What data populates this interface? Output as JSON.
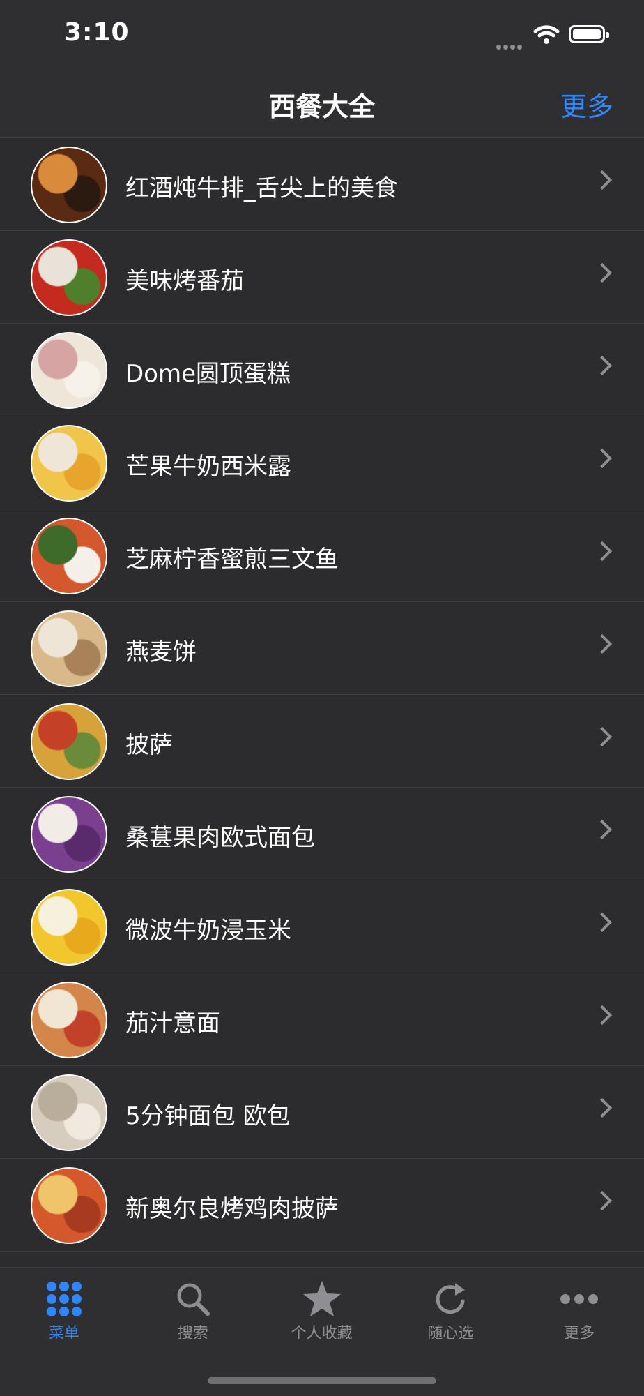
{
  "status": {
    "time": "3:10"
  },
  "nav": {
    "title": "西餐大全",
    "more": "更多"
  },
  "items": [
    {
      "label": "红酒炖牛排_舌尖上的美食",
      "colors": [
        "#5a2a12",
        "#d98a3a",
        "#2b1a10"
      ]
    },
    {
      "label": "美味烤番茄",
      "colors": [
        "#c42a1e",
        "#e8e2d8",
        "#4f7f2a"
      ]
    },
    {
      "label": "Dome圆顶蛋糕",
      "colors": [
        "#efe6da",
        "#d7a4a4",
        "#f6f2ea"
      ]
    },
    {
      "label": "芒果牛奶西米露",
      "colors": [
        "#f1c44a",
        "#efe6d8",
        "#e8a52e"
      ]
    },
    {
      "label": "芝麻柠香蜜煎三文鱼",
      "colors": [
        "#d4572d",
        "#3f6b2a",
        "#f4efe8"
      ]
    },
    {
      "label": "燕麦饼",
      "colors": [
        "#d9b98a",
        "#efe5d6",
        "#a8835a"
      ]
    },
    {
      "label": "披萨",
      "colors": [
        "#d8a23a",
        "#c44127",
        "#6a8c3a"
      ]
    },
    {
      "label": "桑葚果肉欧式面包",
      "colors": [
        "#7a3f8f",
        "#f1ece6",
        "#5a2b6c"
      ]
    },
    {
      "label": "微波牛奶浸玉米",
      "colors": [
        "#f2c72e",
        "#f7f0dc",
        "#e9a91c"
      ]
    },
    {
      "label": "茄汁意面",
      "colors": [
        "#d4864a",
        "#f1e6d4",
        "#c2412a"
      ]
    },
    {
      "label": "5分钟面包 欧包",
      "colors": [
        "#d7cdbf",
        "#b9ad9c",
        "#efe9e0"
      ]
    },
    {
      "label": "新奥尔良烤鸡肉披萨",
      "colors": [
        "#d4582b",
        "#f0c46a",
        "#a83a20"
      ]
    }
  ],
  "tabs": [
    {
      "label": "菜单",
      "icon": "grid-icon",
      "active": true
    },
    {
      "label": "搜索",
      "icon": "search-icon",
      "active": false
    },
    {
      "label": "个人收藏",
      "icon": "star-icon",
      "active": false
    },
    {
      "label": "随心选",
      "icon": "refresh-icon",
      "active": false
    },
    {
      "label": "更多",
      "icon": "more-dots-icon",
      "active": false
    }
  ],
  "accent": "#2f86ff"
}
